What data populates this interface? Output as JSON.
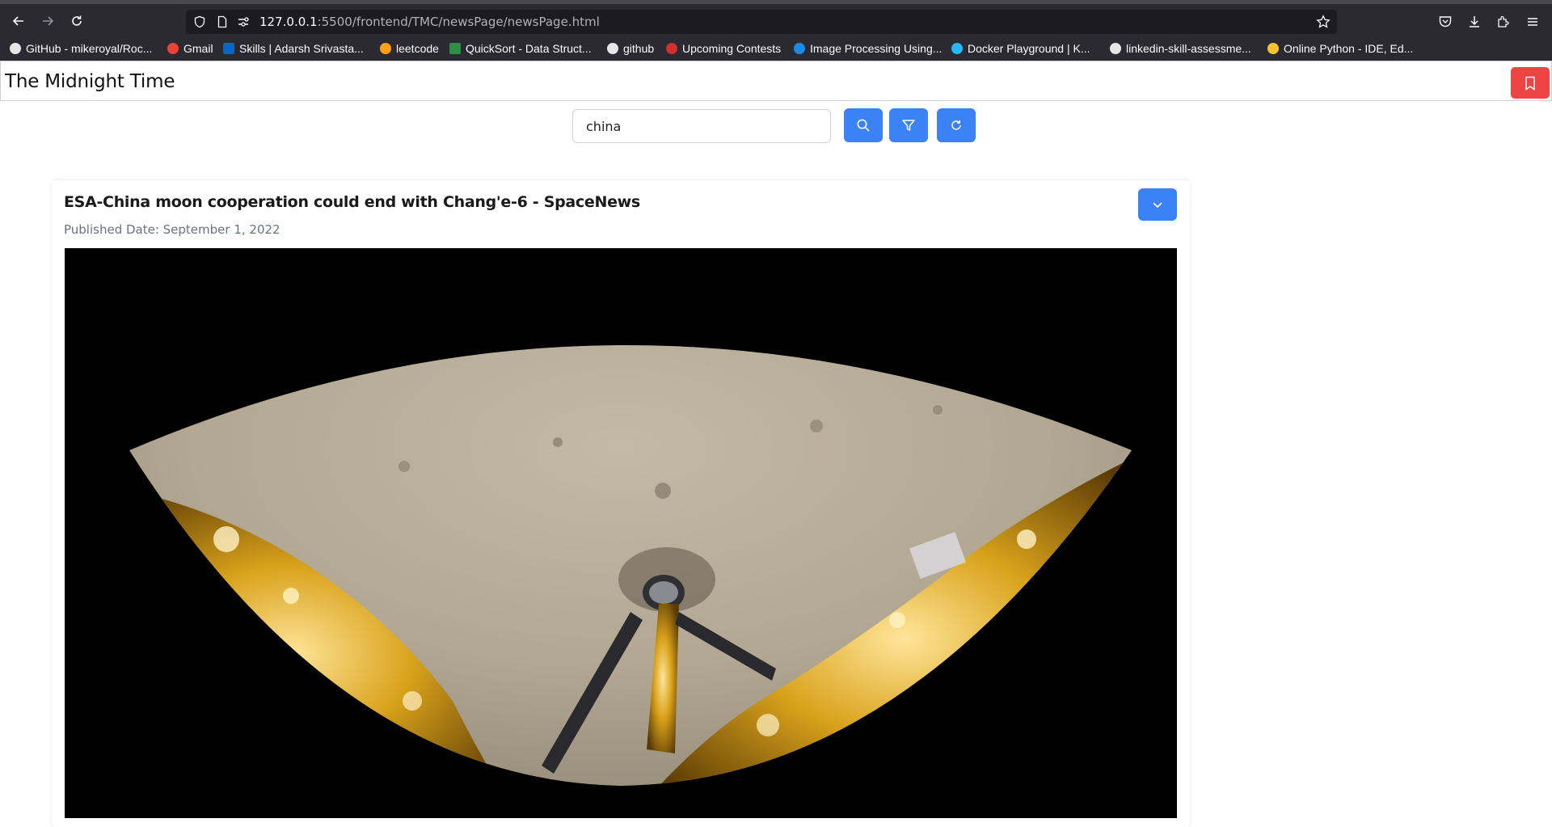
{
  "browser": {
    "url_host": "127.0.0.1",
    "url_rest": ":5500/frontend/TMC/newsPage/newsPage.html",
    "icons": [
      "back-icon",
      "forward-icon",
      "reload-icon",
      "shield-icon",
      "page-icon",
      "permissions-icon",
      "star-icon",
      "pocket-icon",
      "download-icon",
      "extensions-icon",
      "menu-icon"
    ]
  },
  "bookmarks": [
    {
      "label": "GitHub - mikeroyal/Roc...",
      "icon": "github-icon",
      "color": "#e6e6e6"
    },
    {
      "label": "Gmail",
      "icon": "gmail-icon",
      "color": "#ea4335"
    },
    {
      "label": "Skills | Adarsh Srivasta...",
      "icon": "linkedin-icon",
      "color": "#0a66c2"
    },
    {
      "label": "leetcode",
      "icon": "leetcode-icon",
      "color": "#ffa116"
    },
    {
      "label": "QuickSort - Data Struct...",
      "icon": "gfg-icon",
      "color": "#2f8d46"
    },
    {
      "label": "github",
      "icon": "github-icon",
      "color": "#e6e6e6"
    },
    {
      "label": "Upcoming Contests",
      "icon": "contest-icon",
      "color": "#d0312d"
    },
    {
      "label": "Image Processing Using...",
      "icon": "bookmark-site-icon",
      "color": "#1e88e5"
    },
    {
      "label": "Docker Playground | K...",
      "icon": "docker-icon",
      "color": "#29b6f6"
    },
    {
      "label": "linkedin-skill-assessme...",
      "icon": "github-icon",
      "color": "#e6e6e6"
    },
    {
      "label": "Online Python - IDE, Ed...",
      "icon": "python-icon",
      "color": "#f4c430"
    }
  ],
  "app": {
    "brand": "The Midnight Time",
    "bookmark_button_icon": "bookmark-icon"
  },
  "search": {
    "value": "china"
  },
  "article": {
    "title": "ESA-China moon cooperation could end with Chang'e-6 - SpaceNews",
    "date": "Published Date: September 1, 2022",
    "image_alt": "Lunar surface panorama from Chang'e lander"
  },
  "colors": {
    "primary": "#3b82f6",
    "danger": "#ef4444",
    "chrome_bg": "#2b2a33",
    "urlbar_bg": "#1c1b22"
  }
}
